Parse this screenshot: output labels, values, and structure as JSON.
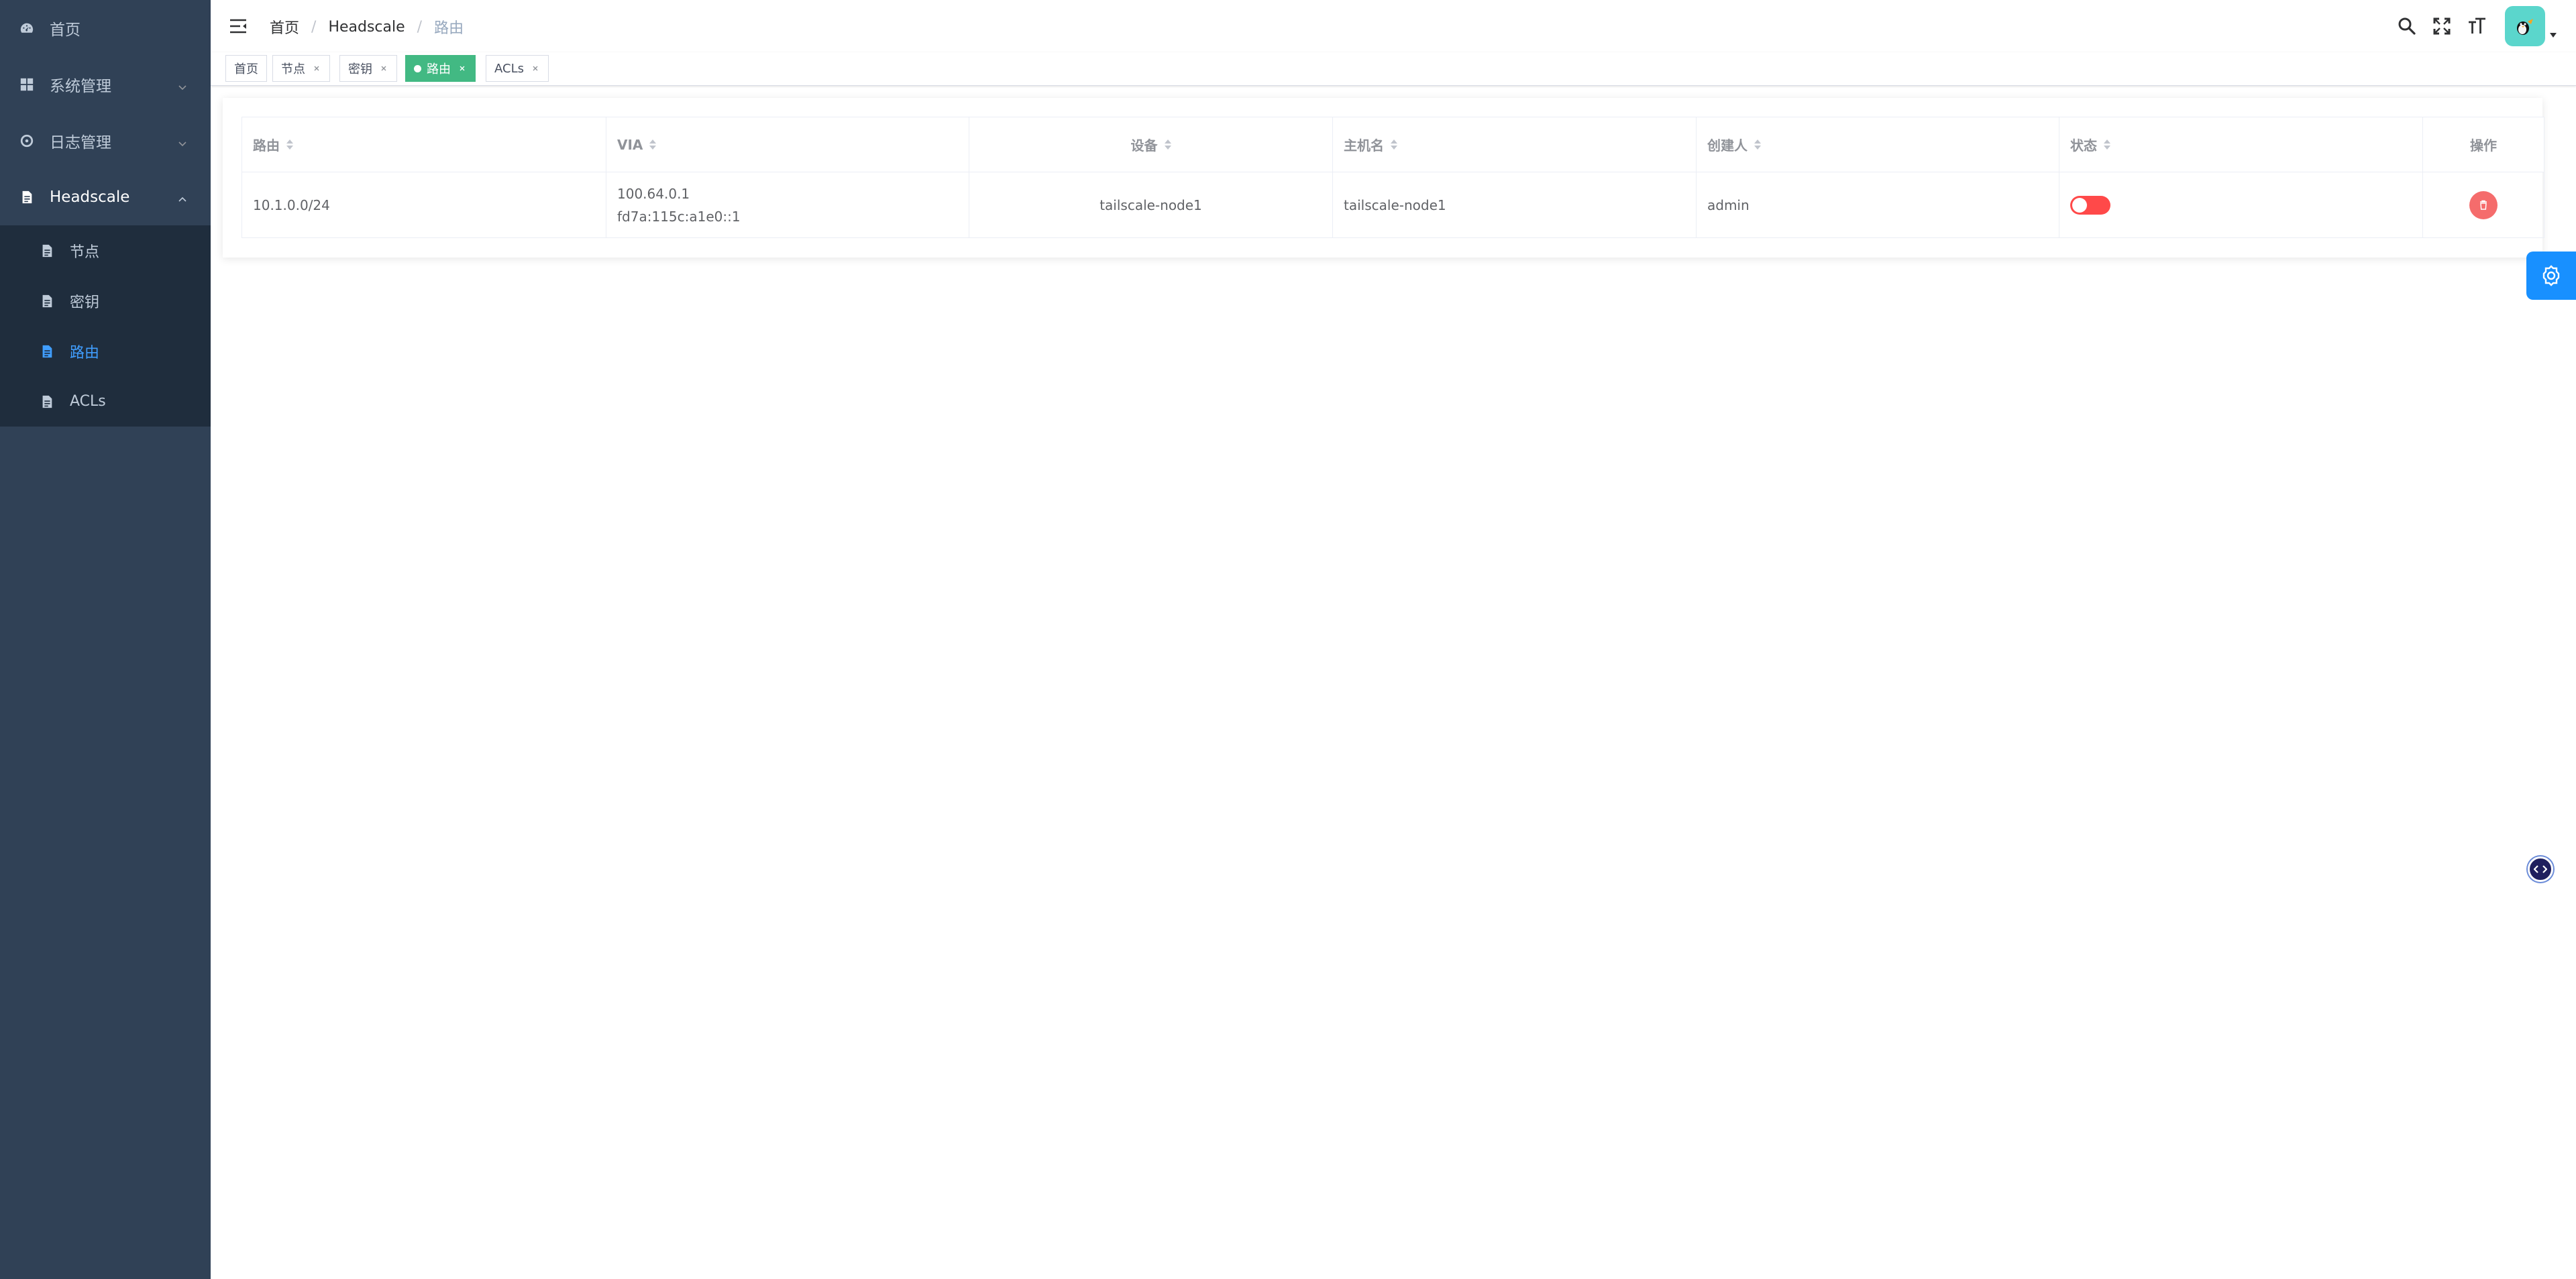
{
  "sidebar": {
    "items": [
      {
        "label": "首页"
      },
      {
        "label": "系统管理"
      },
      {
        "label": "日志管理"
      },
      {
        "label": "Headscale"
      }
    ],
    "sub_items": [
      {
        "label": "节点"
      },
      {
        "label": "密钥"
      },
      {
        "label": "路由"
      },
      {
        "label": "ACLs"
      }
    ],
    "active": "路由"
  },
  "navbar": {
    "breadcrumb": [
      "首页",
      "Headscale",
      "路由"
    ]
  },
  "tags": [
    {
      "label": "首页"
    },
    {
      "label": "节点"
    },
    {
      "label": "密钥"
    },
    {
      "label": "路由"
    },
    {
      "label": "ACLs"
    }
  ],
  "table": {
    "headers": [
      "路由",
      "VIA",
      "设备",
      "主机名",
      "创建人",
      "状态",
      "操作"
    ],
    "rows": [
      {
        "route": "10.1.0.0/24",
        "via": [
          "100.64.0.1",
          "fd7a:115c:a1e0::1"
        ],
        "device": "tailscale-node1",
        "hostname": "tailscale-node1",
        "creator": "admin",
        "status_enabled": false
      }
    ]
  },
  "colors": {
    "sidebar_bg": "#304156",
    "submenu_bg": "#1f2d3d",
    "active_menu": "#409eff",
    "active_tag": "#42b983",
    "switch_off": "#ff4949",
    "danger": "#f56c6c",
    "settings": "#1890ff"
  }
}
